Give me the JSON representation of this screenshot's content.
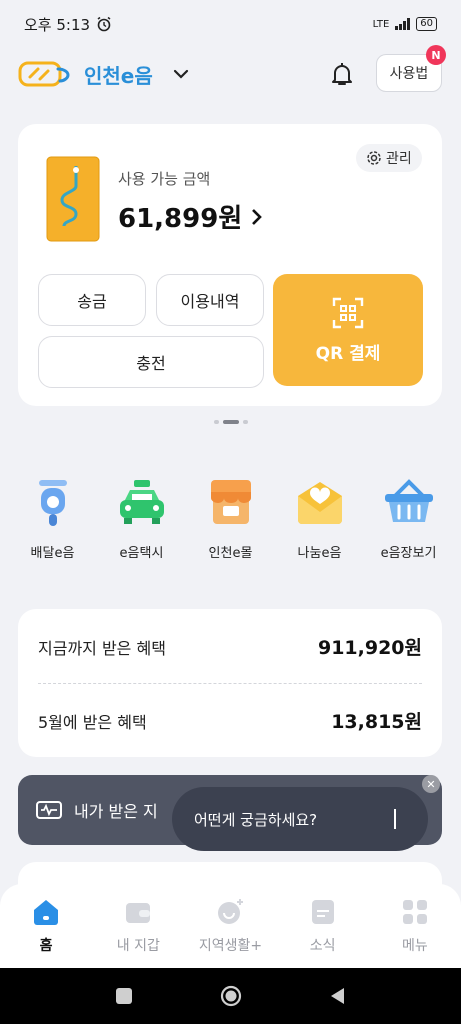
{
  "status_bar": {
    "time": "오후 5:13",
    "alarm_icon": "alarm-clock-icon",
    "network": "LTE",
    "battery": "60"
  },
  "header": {
    "brand": "인천e음",
    "howto_label": "사용법",
    "notification_badge": "N"
  },
  "balance": {
    "available_label": "사용 가능 금액",
    "amount": "61,899원",
    "manage_label": "관리",
    "send_label": "송금",
    "history_label": "이용내역",
    "charge_label": "충전",
    "qr_label": "QR 결제"
  },
  "menu": [
    {
      "label": "배달e음",
      "icon": "delivery-scooter-icon"
    },
    {
      "label": "e음택시",
      "icon": "taxi-icon"
    },
    {
      "label": "인천e몰",
      "icon": "shop-icon"
    },
    {
      "label": "나눔e음",
      "icon": "heart-box-icon"
    },
    {
      "label": "e음장보기",
      "icon": "basket-icon"
    }
  ],
  "benefits": {
    "total_label": "지금까지 받은 혜택",
    "total_value": "911,920원",
    "month_label": "5월에 받은 혜택",
    "month_value": "13,815원"
  },
  "banner": {
    "text": "내가 받은 지"
  },
  "tooltip": {
    "text": "어떤게 궁금하세요?"
  },
  "tabs": [
    {
      "label": "홈",
      "active": true
    },
    {
      "label": "내 지갑",
      "active": false
    },
    {
      "label": "지역생활+",
      "active": false
    },
    {
      "label": "소식",
      "active": false
    },
    {
      "label": "메뉴",
      "active": false
    }
  ],
  "colors": {
    "accent": "#f7b73c",
    "brand_blue": "#2a8fd8",
    "badge": "#f0365a",
    "banner": "#505564"
  }
}
